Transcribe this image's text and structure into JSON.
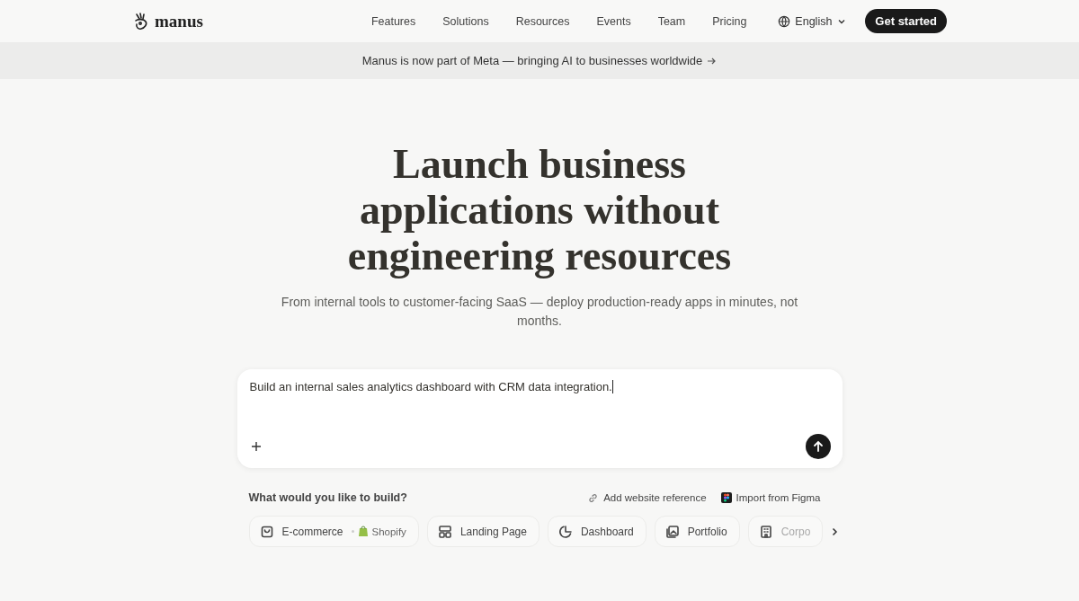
{
  "nav": {
    "logo": "manus",
    "links": [
      "Features",
      "Solutions",
      "Resources",
      "Events",
      "Team",
      "Pricing"
    ],
    "language": "English",
    "cta": "Get started"
  },
  "banner": {
    "text": "Manus is now part of Meta — bringing AI to businesses worldwide"
  },
  "hero": {
    "title": "Launch business applications without engineering resources",
    "subtitle": "From internal tools to customer-facing SaaS — deploy production-ready apps in minutes, not months."
  },
  "prompt": {
    "value": "Build an internal sales analytics dashboard with CRM data integration."
  },
  "build": {
    "label": "What would you like to build?",
    "actions": [
      {
        "kind": "link",
        "label": "Add website reference"
      },
      {
        "kind": "figma",
        "label": "Import from Figma"
      }
    ],
    "chips": [
      {
        "label": "E-commerce",
        "badge": "Shopify"
      },
      {
        "label": "Landing Page"
      },
      {
        "label": "Dashboard"
      },
      {
        "label": "Portfolio"
      },
      {
        "label": "Corpo",
        "faded": true
      }
    ]
  }
}
